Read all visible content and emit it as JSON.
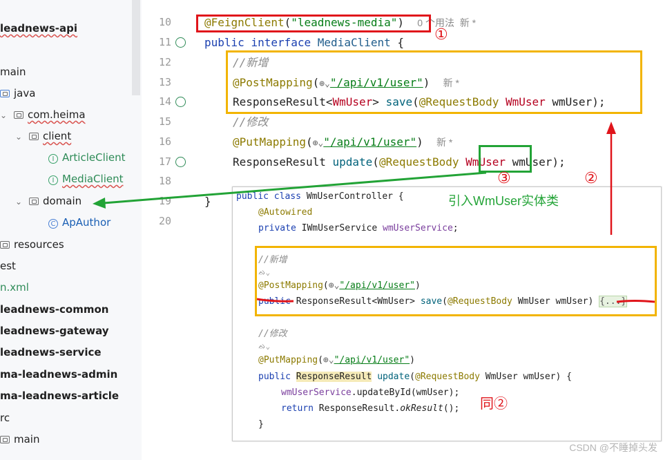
{
  "sidebar": {
    "items": [
      {
        "label": "leadnews-api"
      },
      {
        "label": "main"
      },
      {
        "label": "java"
      },
      {
        "label": "com.heima"
      },
      {
        "label": "client"
      },
      {
        "label": "ArticleClient"
      },
      {
        "label": "MediaClient"
      },
      {
        "label": "domain"
      },
      {
        "label": "ApAuthor"
      },
      {
        "label": "resources"
      },
      {
        "label": "est"
      },
      {
        "label": "n.xml"
      },
      {
        "label": "leadnews-common"
      },
      {
        "label": "leadnews-gateway"
      },
      {
        "label": "leadnews-service"
      },
      {
        "label": "ma-leadnews-admin"
      },
      {
        "label": "ma-leadnews-article"
      },
      {
        "label": "rc"
      },
      {
        "label": "main"
      }
    ]
  },
  "editor": {
    "line_numbers": [
      "10",
      "11",
      "12",
      "13",
      "14",
      "15",
      "16",
      "17",
      "18",
      "19",
      "20"
    ],
    "l10": {
      "annotation": "@FeignClient",
      "p1": "(",
      "str": "\"leadnews-media\"",
      "p2": ")",
      "hint": "0 个用法  新 *"
    },
    "l11": {
      "kw1": "public",
      "kw2": "interface",
      "name": "MediaClient",
      "brace": " {"
    },
    "l12": {
      "comment": "//新增"
    },
    "l13": {
      "annotation": "@PostMapping",
      "p1": "(",
      "globe": "⊕⌄",
      "str": "\"/api/v1/user\"",
      "p2": ")",
      "hint": "新 *"
    },
    "l14": {
      "t1": "ResponseResult<",
      "t2": "WmUser",
      "t3": "> ",
      "fn": "save",
      "p1": "(",
      "ann": "@RequestBody",
      "sp": " ",
      "typ": "WmUser",
      "rest": " wmUser);"
    },
    "l15": {
      "comment": "//修改"
    },
    "l16": {
      "annotation": "@PutMapping",
      "p1": "(",
      "globe": "⊕⌄",
      "str": "\"/api/v1/user\"",
      "p2": ")",
      "hint": "新 *"
    },
    "l17": {
      "t1": "ResponseResult ",
      "fn": "update",
      "p1": "(",
      "ann": "@RequestBody",
      "sp": " ",
      "typ": "WmUser",
      "rest": " wmUser);"
    },
    "l19": {
      "brace": "}"
    }
  },
  "markers": {
    "m1": "①",
    "m2": "②",
    "m3": "③"
  },
  "overlay": {
    "l1": {
      "kw": "public class ",
      "name": "WmUserController {"
    },
    "l2": {
      "ann": "@Autowired"
    },
    "l3": {
      "kw": "private ",
      "typ": "IWmUserService ",
      "var": "wmUserService",
      "end": ";"
    },
    "l4": {
      "comment": "//新增"
    },
    "l5": {
      "sym": "ᨁ⌄"
    },
    "l6": {
      "ann": "@PostMapping",
      "p1": "(",
      "globe": "⊕⌄",
      "str": "\"/api/v1/user\"",
      "p2": ")"
    },
    "l7": {
      "kw": "public ",
      "rest": "ResponseResult<WmUser> ",
      "fn": "save",
      "p1": "(",
      "ann": "@RequestBody",
      "rest2": " WmUser wmUser) ",
      "fold": "{...}"
    },
    "l8": {
      "comment": "//修改"
    },
    "l9": {
      "sym": "ᨁ⌄"
    },
    "l10": {
      "ann": "@PutMapping",
      "p1": "(",
      "globe": "⊕⌄",
      "str": "\"/api/v1/user\"",
      "p2": ")"
    },
    "l11": {
      "kw": "public ",
      "typ": "ResponseResult",
      "sp": " ",
      "fn": "update",
      "p1": "(",
      "ann": "@RequestBody",
      "rest": " WmUser wmUser) {"
    },
    "l12": {
      "var": "wmUserService",
      "rest": ".updateById(wmUser);"
    },
    "l13": {
      "kw": "return ",
      "rest": "ResponseResult.",
      "fn": "okResult",
      "end": "();"
    },
    "l14": {
      "brace": "}"
    },
    "note_import": "引入WmUser实体类",
    "note_same": "同②"
  },
  "watermark": "CSDN @不睡掉头发",
  "colors": {
    "red_box": "#e0151b",
    "yellow_box": "#f2b400",
    "green_box": "#22a336"
  }
}
